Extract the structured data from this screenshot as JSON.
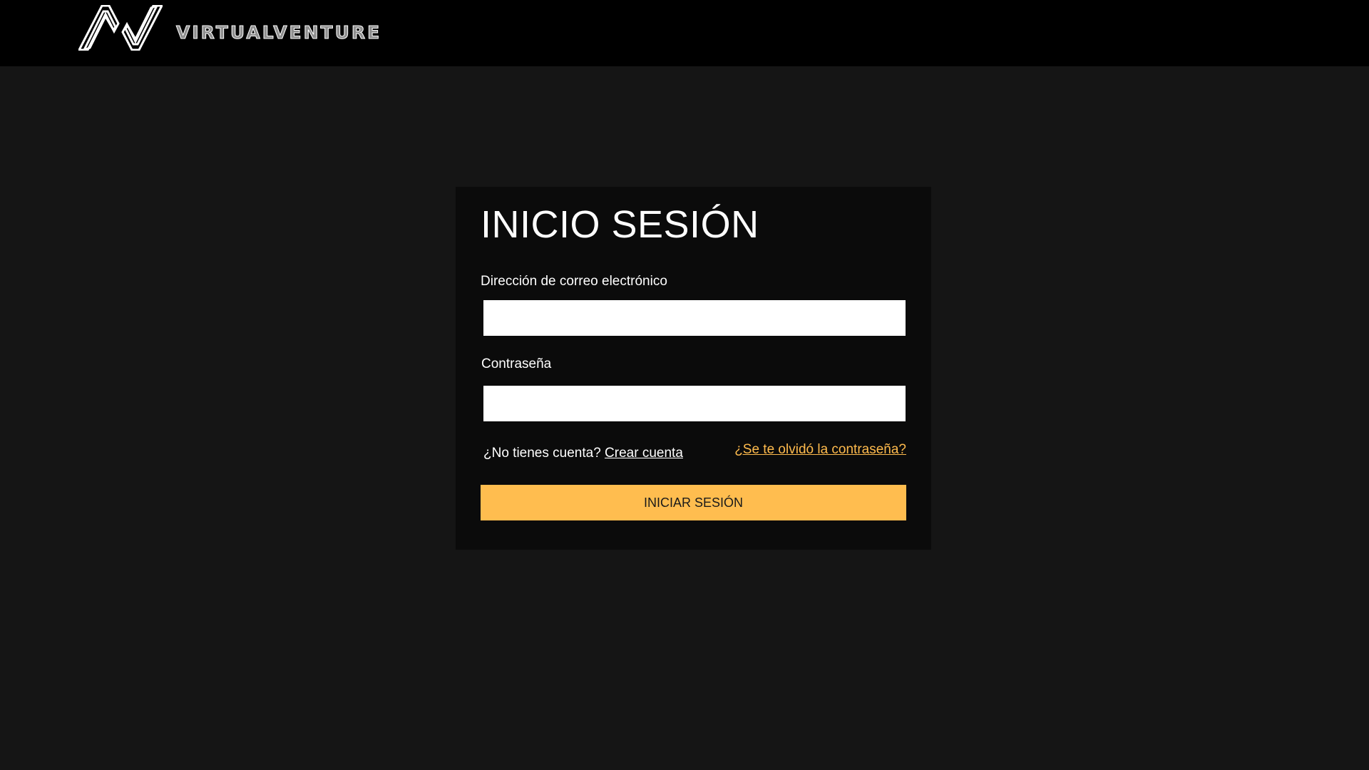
{
  "header": {
    "logo_icon": "av-logo-icon",
    "brand": "VIRTUALVENTURE"
  },
  "login": {
    "title": "INICIO SESIÓN",
    "email_label": "Dirección de correo electrónico",
    "email_value": "",
    "email_placeholder": "",
    "password_label": "Contraseña",
    "password_value": "",
    "password_placeholder": "",
    "no_account_text": "¿No tienes cuenta?",
    "create_account_link": "Crear cuenta",
    "forgot_password_link": "¿Se te olvidó la contraseña?",
    "submit_label": "INICIAR SESIÓN"
  },
  "colors": {
    "page_background": "#151515",
    "header_background": "#000000",
    "card_background": "#0b0b0b",
    "accent": "#ffbd4f"
  }
}
